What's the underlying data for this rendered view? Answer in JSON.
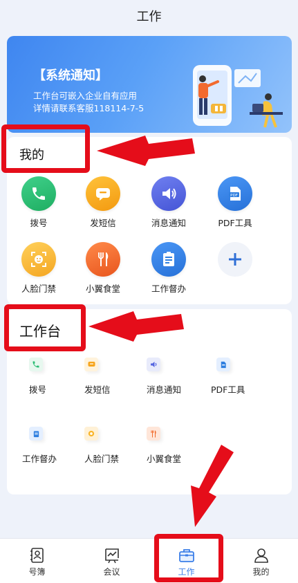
{
  "header": {
    "title": "工作"
  },
  "banner": {
    "title": "【系统通知】",
    "line1": "工作台可嵌入企业自有应用",
    "line2": "详情请联系客服118114-7-5"
  },
  "mine": {
    "title": "我的",
    "apps": [
      {
        "label": "拨号",
        "icon": "phone-icon",
        "color": "#2bbd74"
      },
      {
        "label": "发短信",
        "icon": "message-icon",
        "color": "#f7a51c"
      },
      {
        "label": "消息通知",
        "icon": "speaker-icon",
        "color": "#5566e0"
      },
      {
        "label": "PDF工具",
        "icon": "pdf-icon",
        "color": "#2f7fe0"
      },
      {
        "label": "人脸门禁",
        "icon": "face-icon",
        "color": "#f9b52a"
      },
      {
        "label": "小翼食堂",
        "icon": "fork-knife-icon",
        "color": "#f06a2a"
      },
      {
        "label": "工作督办",
        "icon": "supervise-icon",
        "color": "#2f7fe0"
      },
      {
        "label": "",
        "icon": "add-icon",
        "color": "#2f6fd6"
      }
    ]
  },
  "workbench": {
    "title": "工作台",
    "tools": [
      {
        "label": "拨号",
        "icon": "phone-icon",
        "color": "#2bbd74"
      },
      {
        "label": "发短信",
        "icon": "message-icon",
        "color": "#f7a51c"
      },
      {
        "label": "消息通知",
        "icon": "speaker-icon",
        "color": "#5566e0"
      },
      {
        "label": "PDF工具",
        "icon": "pdf-icon",
        "color": "#2f7fe0"
      },
      {
        "label": "工作督办",
        "icon": "supervise-icon",
        "color": "#2f7fe0"
      },
      {
        "label": "人脸门禁",
        "icon": "face-icon",
        "color": "#f9b52a"
      },
      {
        "label": "小翼食堂",
        "icon": "fork-knife-icon",
        "color": "#f06a2a"
      }
    ]
  },
  "tabbar": {
    "active": "工作",
    "active_color": "#3b7ee8",
    "tabs": [
      {
        "label": "号簿",
        "icon": "contacts-icon"
      },
      {
        "label": "会议",
        "icon": "meeting-icon"
      },
      {
        "label": "工作",
        "icon": "briefcase-icon"
      },
      {
        "label": "我的",
        "icon": "profile-icon"
      }
    ]
  },
  "annotation_color": "#e50d1a"
}
